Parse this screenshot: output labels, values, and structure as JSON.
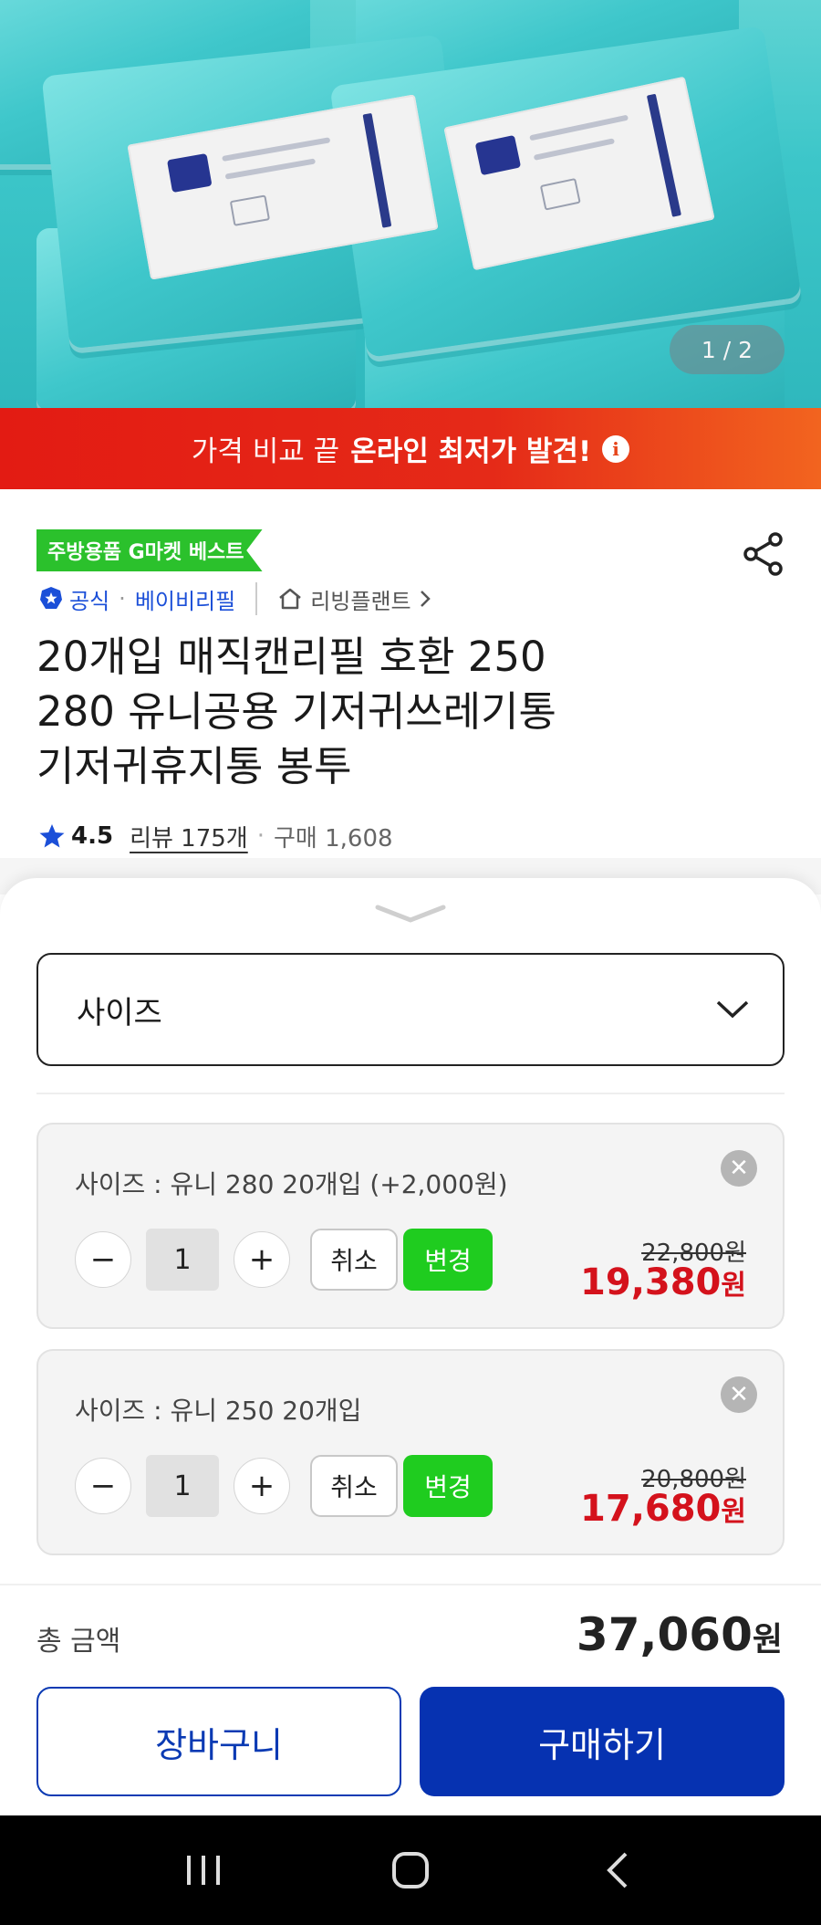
{
  "hero": {
    "counter": "1 / 2"
  },
  "promo": {
    "text_light": "가격 비교 끝",
    "text_bold": "온라인 최저가 발견!",
    "info_icon": "i"
  },
  "product": {
    "badge": "주방용품 G마켓 베스트",
    "official": "공식",
    "brand": "베이비리필",
    "shop": "리빙플랜트",
    "title_line1": "20개입 매직캔리필 호환 250",
    "title_line2": "280 유니공용 기저귀쓰레기통",
    "title_line3": "기저귀휴지통 봉투",
    "rating": "4.5",
    "reviews": "리뷰 175개",
    "purchases": "구매 1,608"
  },
  "sheet": {
    "select_label": "사이즈",
    "options": [
      {
        "name": "사이즈 : 유니 280 20개입 (+2,000원)",
        "qty": "1",
        "cancel": "취소",
        "change": "변경",
        "original_price": "22,800원",
        "sale_price": "19,380",
        "won": "원"
      },
      {
        "name": "사이즈 : 유니 250 20개입",
        "qty": "1",
        "cancel": "취소",
        "change": "변경",
        "original_price": "20,800원",
        "sale_price": "17,680",
        "won": "원"
      }
    ],
    "total_label": "총 금액",
    "total_value": "37,060",
    "total_won": "원",
    "cart_button": "장바구니",
    "buy_button": "구매하기"
  },
  "colors": {
    "brand_blue": "#0632b1",
    "sale_red": "#d4121c",
    "green": "#1fcc1f",
    "promo_red": "#e31b13"
  }
}
